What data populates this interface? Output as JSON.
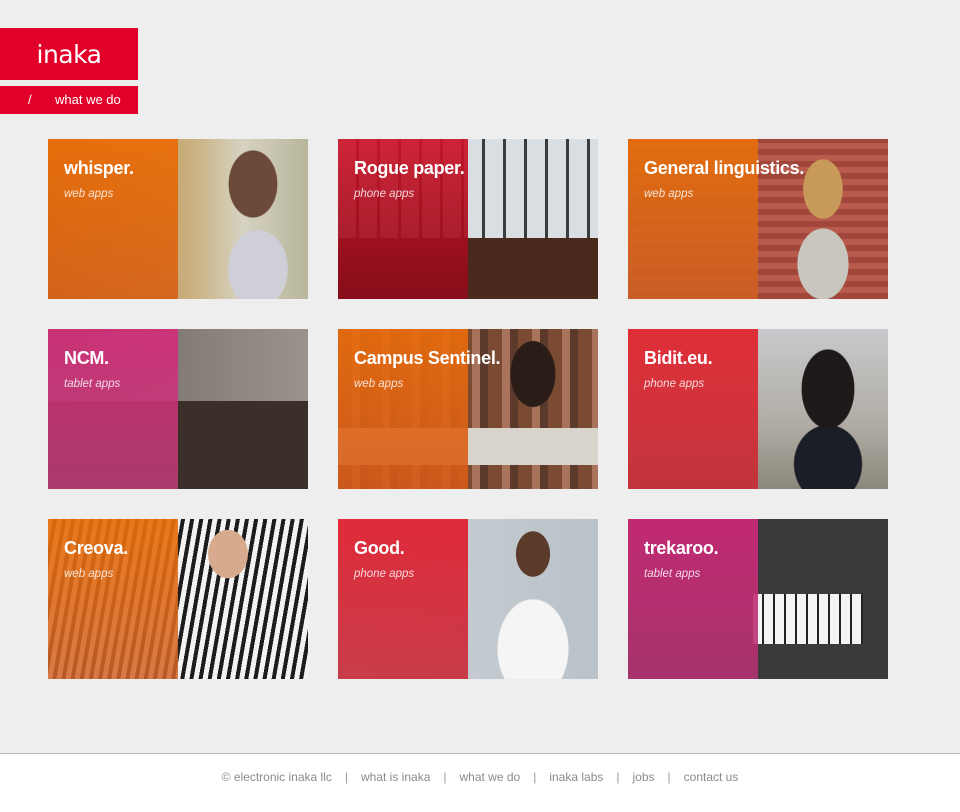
{
  "brand": {
    "name": "inaka",
    "color": "#e2002a"
  },
  "breadcrumb": {
    "separator": "/",
    "current": "what we do"
  },
  "projects": [
    {
      "name": "whisper",
      "category": "web apps",
      "tint": "orange"
    },
    {
      "name": "Rogue paper",
      "category": "phone apps",
      "tint": "red"
    },
    {
      "name": "General linguistics",
      "category": "web apps",
      "tint": "orange"
    },
    {
      "name": "NCM",
      "category": "tablet apps",
      "tint": "pink"
    },
    {
      "name": "Campus Sentinel",
      "category": "web apps",
      "tint": "orange"
    },
    {
      "name": "Bidit.eu",
      "category": "phone apps",
      "tint": "red"
    },
    {
      "name": "Creova",
      "category": "web apps",
      "tint": "orange"
    },
    {
      "name": "Good",
      "category": "phone apps",
      "tint": "red"
    },
    {
      "name": "trekaroo",
      "category": "tablet apps",
      "tint": "pink"
    }
  ],
  "footer": {
    "copyright": "© electronic inaka llc",
    "links": [
      "what is inaka",
      "what we do",
      "inaka labs",
      "jobs",
      "contact us"
    ],
    "separator": "|"
  }
}
